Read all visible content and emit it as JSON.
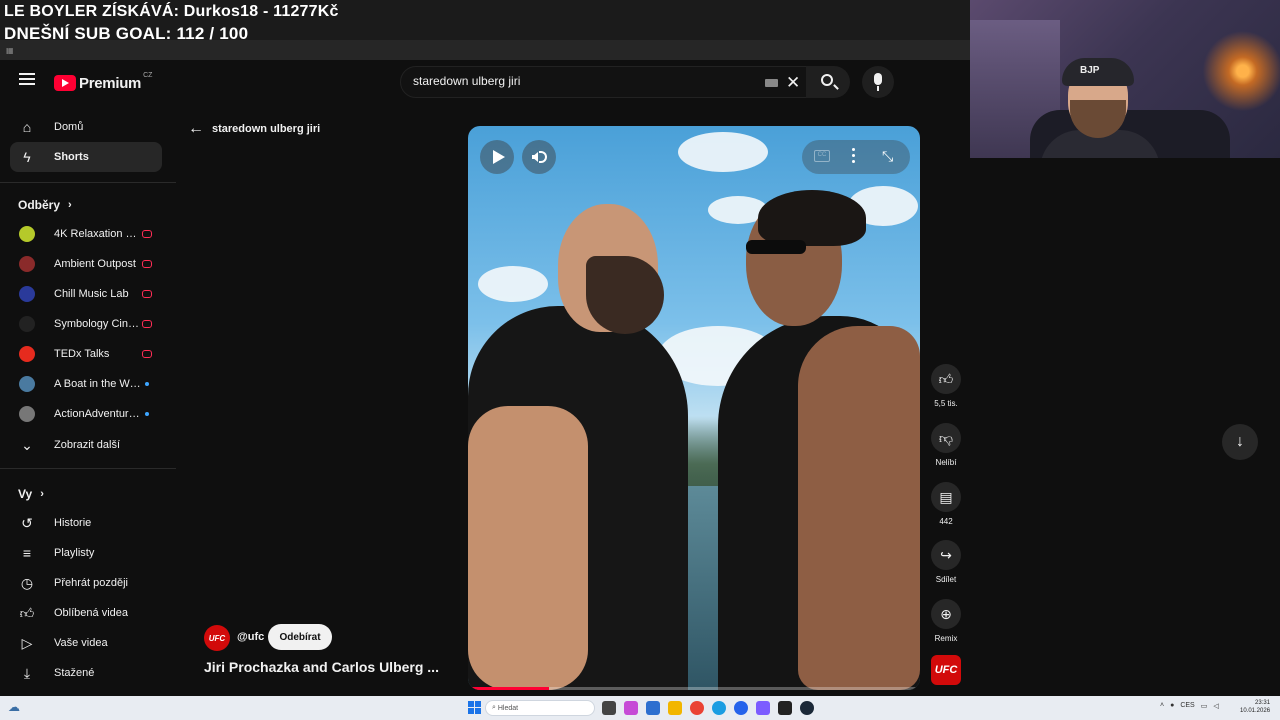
{
  "overlay": {
    "line1": "LE BOYLER ZÍSKÁVÁ: Durkos18 - 11277Kč",
    "line2": "DNEŠNÍ SUB GOAL: 112 / 100"
  },
  "webcam": {
    "cap_text": "BJP"
  },
  "masthead": {
    "logo_text": "Premium",
    "country_code": "CZ",
    "search_value": "staredown ulberg jiri",
    "colors": {
      "brand": "#ff0033",
      "background": "#0f0f0f"
    }
  },
  "sidebar": {
    "main": [
      {
        "label": "Domů",
        "icon": "home-icon"
      },
      {
        "label": "Shorts",
        "icon": "shorts-icon"
      }
    ],
    "subscriptions_title": "Odběry",
    "subscriptions": [
      {
        "label": "4K Relaxation Ch...",
        "status": "live",
        "color": "#b5c92a"
      },
      {
        "label": "Ambient Outpost",
        "status": "live",
        "color": "#8a2a2a"
      },
      {
        "label": "Chill Music Lab",
        "status": "live",
        "color": "#2a3a9a"
      },
      {
        "label": "Symbology Cine...",
        "status": "live",
        "color": "#222222"
      },
      {
        "label": "TEDx Talks",
        "status": "live",
        "color": "#e62b1e"
      },
      {
        "label": "A Boat in the Wo...",
        "status": "new",
        "color": "#4a7aa0"
      },
      {
        "label": "ActionAdventure...",
        "status": "new",
        "color": "#777777"
      }
    ],
    "show_more": "Zobrazit další",
    "you_title": "Vy",
    "you": [
      {
        "label": "Historie",
        "icon": "history-icon"
      },
      {
        "label": "Playlisty",
        "icon": "playlists-icon"
      },
      {
        "label": "Přehrát později",
        "icon": "watch-later-icon"
      },
      {
        "label": "Oblíbená videa",
        "icon": "liked-videos-icon"
      },
      {
        "label": "Vaše videa",
        "icon": "your-videos-icon"
      },
      {
        "label": "Stažené",
        "icon": "downloads-icon"
      }
    ]
  },
  "shorts": {
    "back_label": "staredown ulberg jiri",
    "channel_handle": "@ufc",
    "channel_badge": "UFC",
    "subscribe_label": "Odebírat",
    "title": "Jiri Prochazka and Carlos Ulberg ...",
    "progress": 0.18,
    "actions": {
      "like": "5,5 tis.",
      "dislike": "Nelíbí",
      "comments": "442",
      "share": "Sdílet",
      "remix": "Remix"
    },
    "cc_label": "CC"
  },
  "taskbar": {
    "search_placeholder": "Hledat",
    "tray_lang": "CES",
    "time": "23:31",
    "date": "10.01.2026"
  }
}
